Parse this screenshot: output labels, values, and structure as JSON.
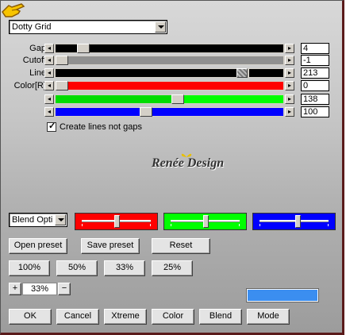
{
  "preset_dropdown": {
    "value": "Dotty Grid"
  },
  "sliders": [
    {
      "label": "Gap:",
      "value": "4",
      "fill_left": "#000000",
      "fill_right": "#000000",
      "thumb": 0.1
    },
    {
      "label": "Cutoff:",
      "value": "-1",
      "fill_left": "#909090",
      "fill_right": "#909090",
      "thumb": 0.0
    },
    {
      "label": "Line:",
      "value": "213",
      "fill_left": "#000000",
      "fill_right": "#000000",
      "thumb": 0.84
    },
    {
      "label": "Color[R]:",
      "value": "0",
      "fill_left": "#ff0000",
      "fill_right": "#ff0000",
      "thumb": 0.0
    },
    {
      "label": "",
      "value": "138",
      "fill_left": "#00dd00",
      "fill_right": "#00ff00",
      "thumb": 0.54
    },
    {
      "label": "",
      "value": "100",
      "fill_left": "#0000ff",
      "fill_right": "#0000ff",
      "thumb": 0.39
    }
  ],
  "checkbox": {
    "label": "Create lines not gaps",
    "checked": true
  },
  "logo_text": "Renée Design",
  "blend_dropdown": {
    "value": "Blend Opti"
  },
  "color_panels": [
    {
      "color": "#ff0000",
      "knob": 0.5
    },
    {
      "color": "#00ff00",
      "knob": 0.5
    },
    {
      "color": "#0000ff",
      "knob": 0.55
    }
  ],
  "preset_buttons": {
    "open": "Open preset",
    "save": "Save preset",
    "reset": "Reset"
  },
  "zoom_buttons": [
    "100%",
    "50%",
    "33%",
    "25%"
  ],
  "zoom": {
    "plus": "+",
    "value": "33%",
    "minus": "−"
  },
  "preview_color": "#3b8ef0",
  "bottom_buttons": [
    "OK",
    "Cancel",
    "Xtreme",
    "Color",
    "Blend",
    "Mode"
  ]
}
